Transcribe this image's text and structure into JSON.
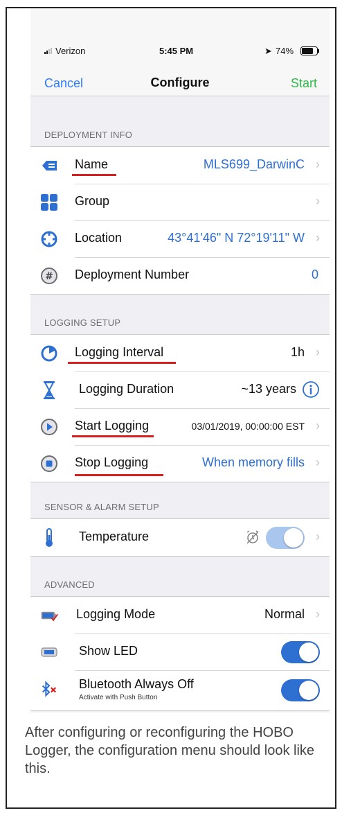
{
  "status_bar": {
    "carrier": "Verizon",
    "time": "5:45 PM",
    "battery": "74%"
  },
  "nav": {
    "cancel": "Cancel",
    "title": "Configure",
    "start": "Start"
  },
  "sections": {
    "deployment_info": "DEPLOYMENT INFO",
    "logging_setup": "LOGGING SETUP",
    "sensor_alarm": "SENSOR & ALARM SETUP",
    "advanced": "ADVANCED"
  },
  "deployment": {
    "name_label": "Name",
    "name_value": "MLS699_DarwinC",
    "group_label": "Group",
    "location_label": "Location",
    "location_value": "43°41'46\" N 72°19'11\" W",
    "number_label": "Deployment Number",
    "number_value": "0"
  },
  "logging": {
    "interval_label": "Logging Interval",
    "interval_value": "1h",
    "duration_label": "Logging Duration",
    "duration_value": "~13 years",
    "start_label": "Start Logging",
    "start_value": "03/01/2019, 00:00:00 EST",
    "stop_label": "Stop Logging",
    "stop_value": "When memory fills"
  },
  "sensor": {
    "temperature_label": "Temperature"
  },
  "advanced": {
    "mode_label": "Logging Mode",
    "mode_value": "Normal",
    "led_label": "Show LED",
    "bt_label": "Bluetooth Always Off",
    "bt_sub": "Activate with Push Button"
  },
  "colors": {
    "accent": "#2e6fd2",
    "start": "#2db84a",
    "underline": "#d8201e"
  },
  "caption": "After configuring or reconfiguring the HOBO Logger, the configuration menu should look like this."
}
